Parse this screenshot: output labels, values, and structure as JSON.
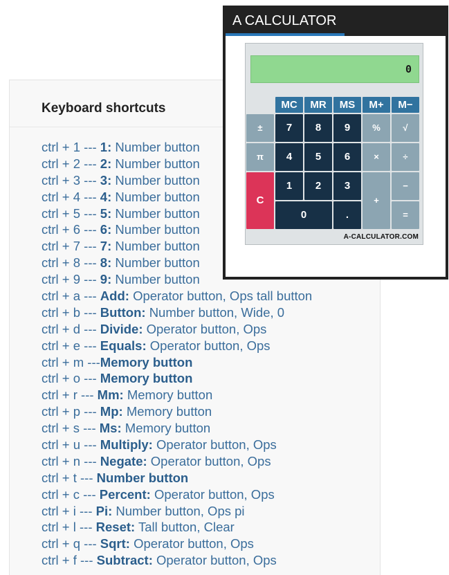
{
  "shortcuts": {
    "title": "Keyboard shortcuts",
    "items": [
      {
        "keys": "ctrl + 1 --- ",
        "name": "1:",
        "desc": "Number button"
      },
      {
        "keys": "ctrl + 2 --- ",
        "name": "2:",
        "desc": "Number button"
      },
      {
        "keys": "ctrl + 3 --- ",
        "name": "3:",
        "desc": "Number button"
      },
      {
        "keys": "ctrl + 4 --- ",
        "name": "4:",
        "desc": "Number button"
      },
      {
        "keys": "ctrl + 5 --- ",
        "name": "5:",
        "desc": "Number button"
      },
      {
        "keys": "ctrl + 6 --- ",
        "name": "6:",
        "desc": "Number button"
      },
      {
        "keys": "ctrl + 7 --- ",
        "name": "7:",
        "desc": "Number button"
      },
      {
        "keys": "ctrl + 8 --- ",
        "name": "8:",
        "desc": "Number button"
      },
      {
        "keys": "ctrl + 9 --- ",
        "name": "9:",
        "desc": "Number button"
      },
      {
        "keys": "ctrl + a --- ",
        "name": "Add:",
        "desc": "Operator button, Ops tall button"
      },
      {
        "keys": "ctrl + b --- ",
        "name": "Button:",
        "desc": "Number button, Wide, 0"
      },
      {
        "keys": "ctrl + d --- ",
        "name": "Divide:",
        "desc": "Operator button, Ops"
      },
      {
        "keys": "ctrl + e --- ",
        "name": "Equals:",
        "desc": "Operator button, Ops"
      },
      {
        "keys": "ctrl + m ---",
        "name": "Memory button",
        "desc": ""
      },
      {
        "keys": "ctrl + o --- ",
        "name": "Memory button",
        "desc": ""
      },
      {
        "keys": "ctrl + r ---  ",
        "name": "Mm:",
        "desc": "Memory button"
      },
      {
        "keys": "ctrl + p ---  ",
        "name": "Mp:",
        "desc": "Memory button"
      },
      {
        "keys": "ctrl + s ---  ",
        "name": "Ms:",
        "desc": "Memory button"
      },
      {
        "keys": "ctrl + u --- ",
        "name": "Multiply:",
        "desc": "Operator button, Ops"
      },
      {
        "keys": "ctrl + n --- ",
        "name": "Negate:",
        "desc": "Operator button, Ops"
      },
      {
        "keys": "ctrl + t ---  ",
        "name": "Number button",
        "desc": ""
      },
      {
        "keys": "ctrl + c --- ",
        "name": "Percent:",
        "desc": "Operator button, Ops"
      },
      {
        "keys": "ctrl + i ---  ",
        "name": "Pi:",
        "desc": "Number button, Ops pi"
      },
      {
        "keys": "ctrl + l ---  ",
        "name": "Reset:",
        "desc": "Tall button, Clear"
      },
      {
        "keys": "ctrl + q --- ",
        "name": "Sqrt:",
        "desc": "Operator button, Ops"
      },
      {
        "keys": "ctrl + f ---  ",
        "name": "Subtract:",
        "desc": "Operator button, Ops"
      }
    ]
  },
  "calculator": {
    "window_title": "A CALCULATOR",
    "display_value": "0",
    "brand": "A-CALCULATOR.COM",
    "memory_buttons": [
      "MC",
      "MR",
      "MS",
      "M+",
      "M−"
    ],
    "buttons": {
      "negate": "±",
      "seven": "7",
      "eight": "8",
      "nine": "9",
      "percent": "%",
      "sqrt": "√",
      "pi": "π",
      "four": "4",
      "five": "5",
      "six": "6",
      "multiply": "×",
      "divide": "÷",
      "clear": "C",
      "one": "1",
      "two": "2",
      "three": "3",
      "add": "+",
      "subtract": "−",
      "zero": "0",
      "decimal": ".",
      "equals": "="
    },
    "colors": {
      "display": "#90d890",
      "memory": "#31739f",
      "number": "#173046",
      "operator": "#8ca5b2",
      "clear": "#dc3458",
      "accent": "#2a78b8"
    }
  }
}
